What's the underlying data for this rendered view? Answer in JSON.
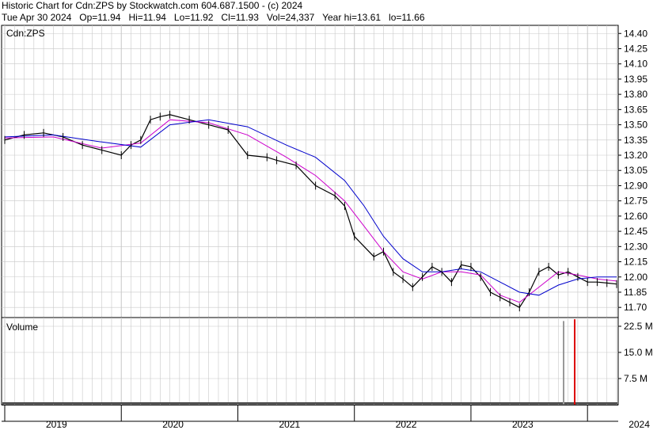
{
  "header": {
    "line1": "Historic Chart for Cdn:ZPS by Stockwatch.com 604.687.1500 - (c) 2024",
    "line2": "Tue Apr 30 2024   Op=11.94   Hi=11.94   Lo=11.92   Cl=11.93   Vol=24,337   Year hi=13.61   lo=11.66"
  },
  "colors": {
    "price": "#000000",
    "ma_short": "#cc00cc",
    "ma_long": "#0000cc",
    "vol_up": "#00aa00",
    "vol_down": "#dd0000",
    "vol_neutral": "#999999",
    "grid": "#c8c8c8"
  },
  "chart_data": [
    {
      "type": "line",
      "title": "Cdn:ZPS",
      "x_start": "2019-01",
      "x_end": "2024-04",
      "ylim": [
        11.6,
        14.48
      ],
      "yticks": [
        "14.40",
        "14.25",
        "14.10",
        "13.95",
        "13.80",
        "13.65",
        "13.50",
        "13.35",
        "13.20",
        "13.05",
        "12.90",
        "12.75",
        "12.60",
        "12.45",
        "12.30",
        "12.15",
        "12.00",
        "11.85",
        "11.70"
      ],
      "series": [
        {
          "name": "",
          "dates": [
            "2019-01",
            "2019-03",
            "2019-05",
            "2019-07",
            "2019-09",
            "2019-11",
            "2020-01",
            "2020-02",
            "2020-03",
            "2020-04",
            "2020-05",
            "2020-06",
            "2020-08",
            "2020-10",
            "2020-12",
            "2021-02",
            "2021-04",
            "2021-05",
            "2021-07",
            "2021-09",
            "2021-11",
            "2021-12",
            "2022-01",
            "2022-03",
            "2022-04",
            "2022-05",
            "2022-06",
            "2022-07",
            "2022-08",
            "2022-09",
            "2022-10",
            "2022-11",
            "2022-12",
            "2023-01",
            "2023-02",
            "2023-03",
            "2023-04",
            "2023-05",
            "2023-06",
            "2023-07",
            "2023-08",
            "2023-09",
            "2023-10",
            "2023-11",
            "2023-12",
            "2024-01",
            "2024-02",
            "2024-03",
            "2024-04"
          ],
          "values": [
            13.35,
            13.4,
            13.42,
            13.38,
            13.3,
            13.25,
            13.2,
            13.3,
            13.35,
            13.55,
            13.58,
            13.6,
            13.55,
            13.5,
            13.45,
            13.2,
            13.18,
            13.15,
            13.1,
            12.9,
            12.8,
            12.7,
            12.4,
            12.2,
            12.25,
            12.05,
            11.98,
            11.9,
            12.0,
            12.1,
            12.05,
            11.95,
            12.12,
            12.1,
            12.0,
            11.85,
            11.8,
            11.75,
            11.7,
            11.85,
            12.05,
            12.1,
            12.02,
            12.05,
            12.0,
            11.95,
            11.95,
            11.94,
            11.93
          ]
        },
        {
          "name": "",
          "dates": [
            "2019-01",
            "2019-06",
            "2019-11",
            "2020-03",
            "2020-06",
            "2020-10",
            "2021-02",
            "2021-06",
            "2021-09",
            "2021-12",
            "2022-02",
            "2022-04",
            "2022-06",
            "2022-08",
            "2022-10",
            "2022-12",
            "2023-02",
            "2023-04",
            "2023-06",
            "2023-08",
            "2023-10",
            "2023-12",
            "2024-02",
            "2024-04"
          ],
          "values": [
            13.37,
            13.38,
            13.27,
            13.32,
            13.55,
            13.52,
            13.4,
            13.18,
            13.0,
            12.75,
            12.5,
            12.25,
            12.05,
            11.98,
            12.05,
            12.05,
            12.02,
            11.82,
            11.75,
            11.9,
            12.05,
            12.02,
            11.98,
            11.96
          ]
        },
        {
          "name": "",
          "dates": [
            "2019-01",
            "2019-06",
            "2019-11",
            "2020-03",
            "2020-06",
            "2020-10",
            "2021-02",
            "2021-06",
            "2021-09",
            "2021-12",
            "2022-02",
            "2022-04",
            "2022-06",
            "2022-08",
            "2022-10",
            "2022-12",
            "2023-02",
            "2023-04",
            "2023-06",
            "2023-08",
            "2023-10",
            "2023-12",
            "2024-02",
            "2024-04"
          ],
          "values": [
            13.38,
            13.4,
            13.33,
            13.28,
            13.5,
            13.55,
            13.48,
            13.3,
            13.18,
            12.95,
            12.7,
            12.4,
            12.18,
            12.05,
            12.05,
            12.08,
            12.05,
            11.95,
            11.85,
            11.82,
            11.92,
            11.98,
            12.0,
            12.0
          ]
        }
      ]
    },
    {
      "type": "bar",
      "title": "Volume",
      "ylim": [
        0,
        25000000
      ],
      "yticks": [
        "22.5 M",
        "15.0 M",
        "7.5 M"
      ],
      "categories": [
        "2023-11-W1",
        "2023-12-W1"
      ],
      "series": [
        {
          "name": "",
          "values": [
            24000000,
            24500000
          ]
        }
      ]
    }
  ],
  "x_axis": {
    "labels": [
      "2019",
      "2020",
      "2021",
      "2022",
      "2023",
      "2024"
    ]
  }
}
